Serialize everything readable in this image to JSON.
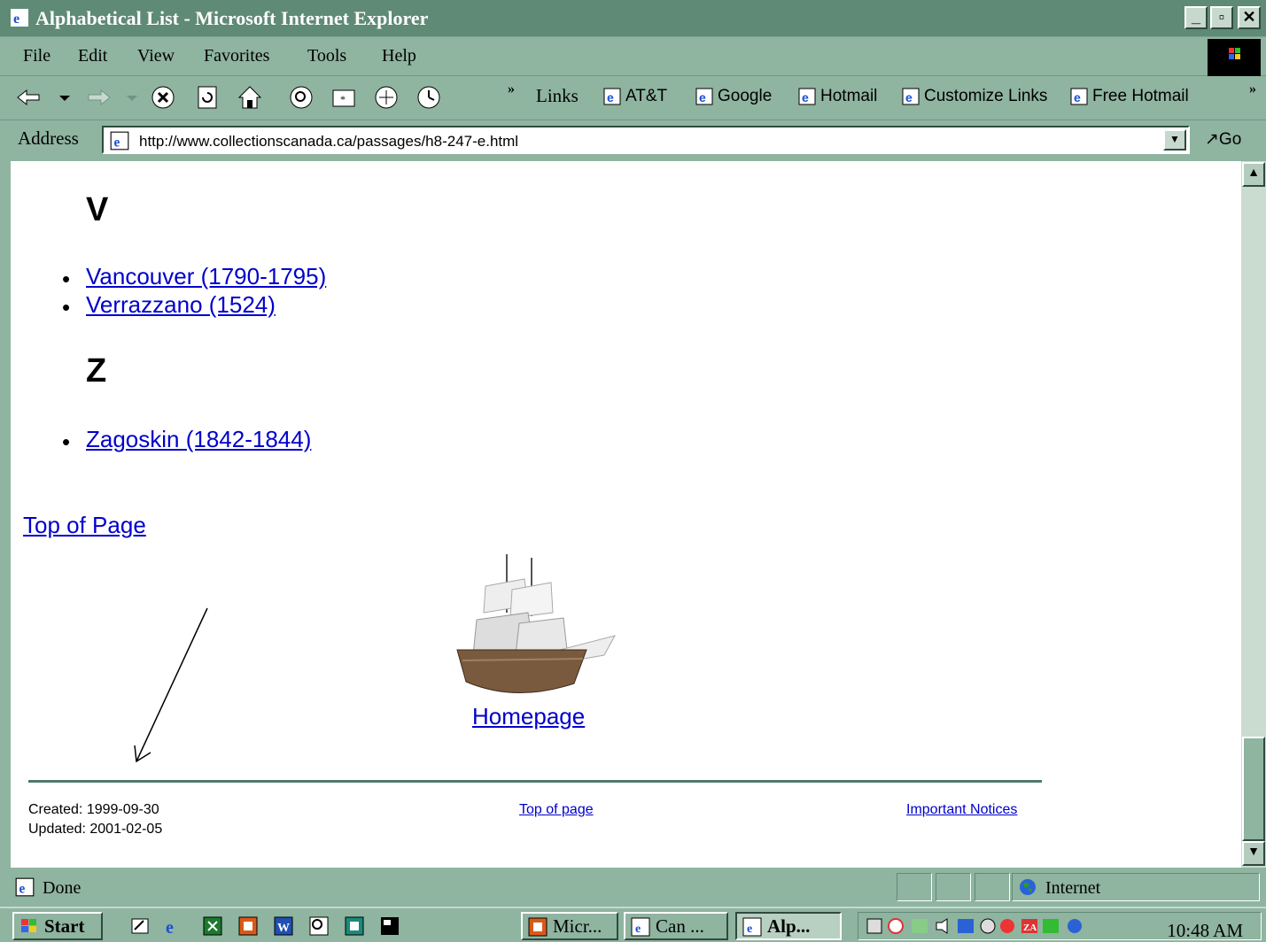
{
  "window": {
    "title": "Alphabetical List - Microsoft Internet Explorer"
  },
  "menu": [
    "File",
    "Edit",
    "View",
    "Favorites",
    "Tools",
    "Help"
  ],
  "links_bar": {
    "label": "Links",
    "items": [
      "AT&T",
      "Google",
      "Hotmail",
      "Customize Links",
      "Free Hotmail"
    ]
  },
  "address": {
    "label": "Address",
    "url": "http://www.collectionscanada.ca/passages/h8-247-e.html",
    "go_label": "Go"
  },
  "content": {
    "section_v": {
      "letter": "V",
      "items": [
        "Vancouver (1790-1795)",
        "Verrazzano (1524)"
      ]
    },
    "section_z": {
      "letter": "Z",
      "items": [
        "Zagoskin (1842-1844)"
      ]
    },
    "top_of_page": "Top of Page",
    "homepage": "Homepage",
    "footer": {
      "created": "Created: 1999-09-30",
      "updated": "Updated: 2001-02-05",
      "top_of_page": "Top of page",
      "important_notices": "Important Notices"
    }
  },
  "status": {
    "text": "Done",
    "zone": "Internet"
  },
  "taskbar": {
    "start": "Start",
    "tasks": [
      "Micr...",
      "Can ...",
      "Alp..."
    ],
    "clock": "10:48 AM"
  },
  "colors": {
    "chrome": "#8fb4a0",
    "titlebar": "#5f8a76",
    "link": "#0000cc",
    "desktop": "#9ea6e8"
  }
}
